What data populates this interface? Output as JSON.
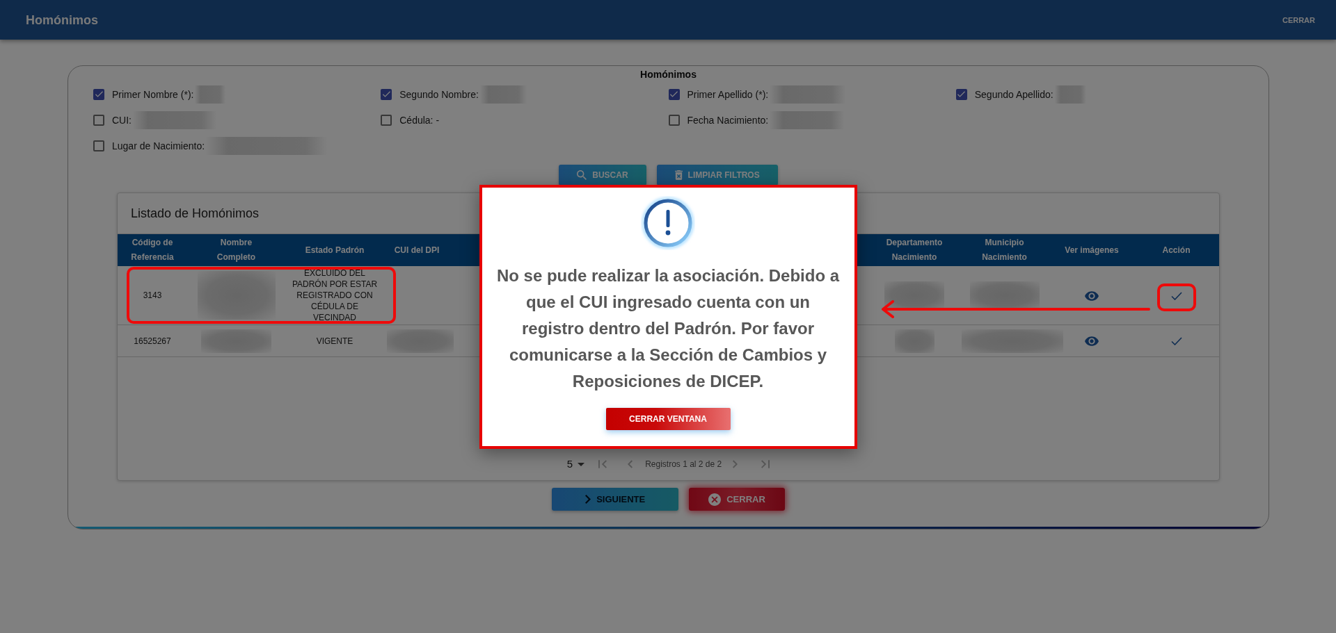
{
  "header": {
    "title": "Homónimos",
    "close_label": "CERRAR"
  },
  "filters": {
    "title": "Homónimos",
    "rows": [
      [
        {
          "label": "Primer Nombre (*):",
          "checked": true,
          "redacted": true
        },
        {
          "label": "Segundo Nombre:",
          "checked": true,
          "redacted": true
        },
        {
          "label": "Primer Apellido (*):",
          "checked": true,
          "redacted": true
        },
        {
          "label": "Segundo Apellido:",
          "checked": true,
          "redacted": true
        }
      ],
      [
        {
          "label": "CUI:",
          "checked": false,
          "redacted": true
        },
        {
          "label": "Cédula: -",
          "checked": false,
          "redacted": false
        },
        {
          "label": "Fecha Nacimiento:",
          "checked": false,
          "redacted": true
        }
      ],
      [
        {
          "label": "Lugar de Nacimiento:",
          "checked": false,
          "redacted": true
        }
      ]
    ]
  },
  "filter_buttons": [
    {
      "kind": "search",
      "label": "BUSCAR"
    },
    {
      "kind": "clear",
      "label": "LIMPIAR FILTROS"
    }
  ],
  "table": {
    "title": "Listado de Homónimos",
    "columns": [
      "Código de Referencia",
      "Nombre Completo",
      "Estado Padrón",
      "CUI del DPI",
      "Departamento Nacimiento",
      "Municipio Nacimiento",
      "Ver imágenes",
      "Acción"
    ],
    "rows": [
      {
        "code": "3143",
        "name_redacted": true,
        "status": "EXCLUIDO DEL PADRÓN POR ESTAR REGISTRADO CON CÉDULA DE VECINDAD",
        "cui_redacted": false,
        "department_redacted": true,
        "municipality_redacted": true,
        "marked": true,
        "action_marked": true,
        "arrow_to_dialog": true
      },
      {
        "code": "16525267",
        "name_redacted": true,
        "status": "VIGENTE",
        "cui_redacted": true,
        "department_redacted": true,
        "municipality_redacted": true,
        "marked": false,
        "action_marked": false,
        "arrow_to_dialog": false
      }
    ]
  },
  "pagination": {
    "page_size": "5",
    "range": "Registros 1 al 2 de 2",
    "controls": [
      {
        "kind": "first",
        "disabled": true
      },
      {
        "kind": "previous",
        "disabled": true
      },
      {
        "kind": "next",
        "disabled": true
      },
      {
        "kind": "last",
        "disabled": true
      }
    ]
  },
  "footer_buttons": [
    {
      "kind": "next",
      "label": "SIGUIENTE",
      "disabled": true
    },
    {
      "kind": "close",
      "label": "CERRAR",
      "disabled": false
    }
  ],
  "dialog": {
    "message": "No se pude realizar la asociación. Debido a que el CUI ingresado cuenta con un registro dentro del Padrón. Por favor comunicarse a la Sección de Cambios y Reposiciones de DICEP.",
    "button": "CERRAR VENTANA",
    "marked": true
  }
}
